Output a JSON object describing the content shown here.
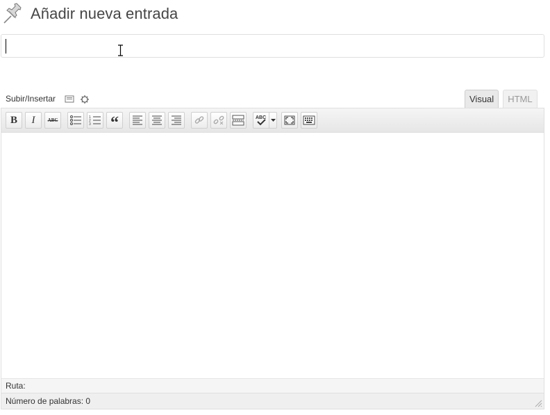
{
  "header": {
    "title": "Añadir nueva entrada",
    "icon": "pushpin-icon"
  },
  "title_field": {
    "value": "",
    "placeholder": ""
  },
  "media": {
    "label": "Subir/Insertar",
    "icons": [
      "media-library-icon",
      "gear-icon"
    ]
  },
  "tabs": [
    {
      "label": "Visual",
      "active": true
    },
    {
      "label": "HTML",
      "active": false
    }
  ],
  "toolbar": {
    "buttons": [
      "bold-icon",
      "italic-icon",
      "strikethrough-icon",
      "bulleted-list-icon",
      "numbered-list-icon",
      "blockquote-icon",
      "align-left-icon",
      "align-center-icon",
      "align-right-icon",
      "insert-link-icon",
      "unlink-icon",
      "insert-more-icon",
      "spellcheck-icon",
      "fullscreen-icon",
      "kitchen-sink-icon"
    ],
    "bold_label": "B",
    "italic_label": "I",
    "strike_label": "ABC",
    "quote_label": "“",
    "spell_label": "ABC"
  },
  "status": {
    "path_label": "Ruta:",
    "word_count_label": "Número de palabras: 0"
  }
}
